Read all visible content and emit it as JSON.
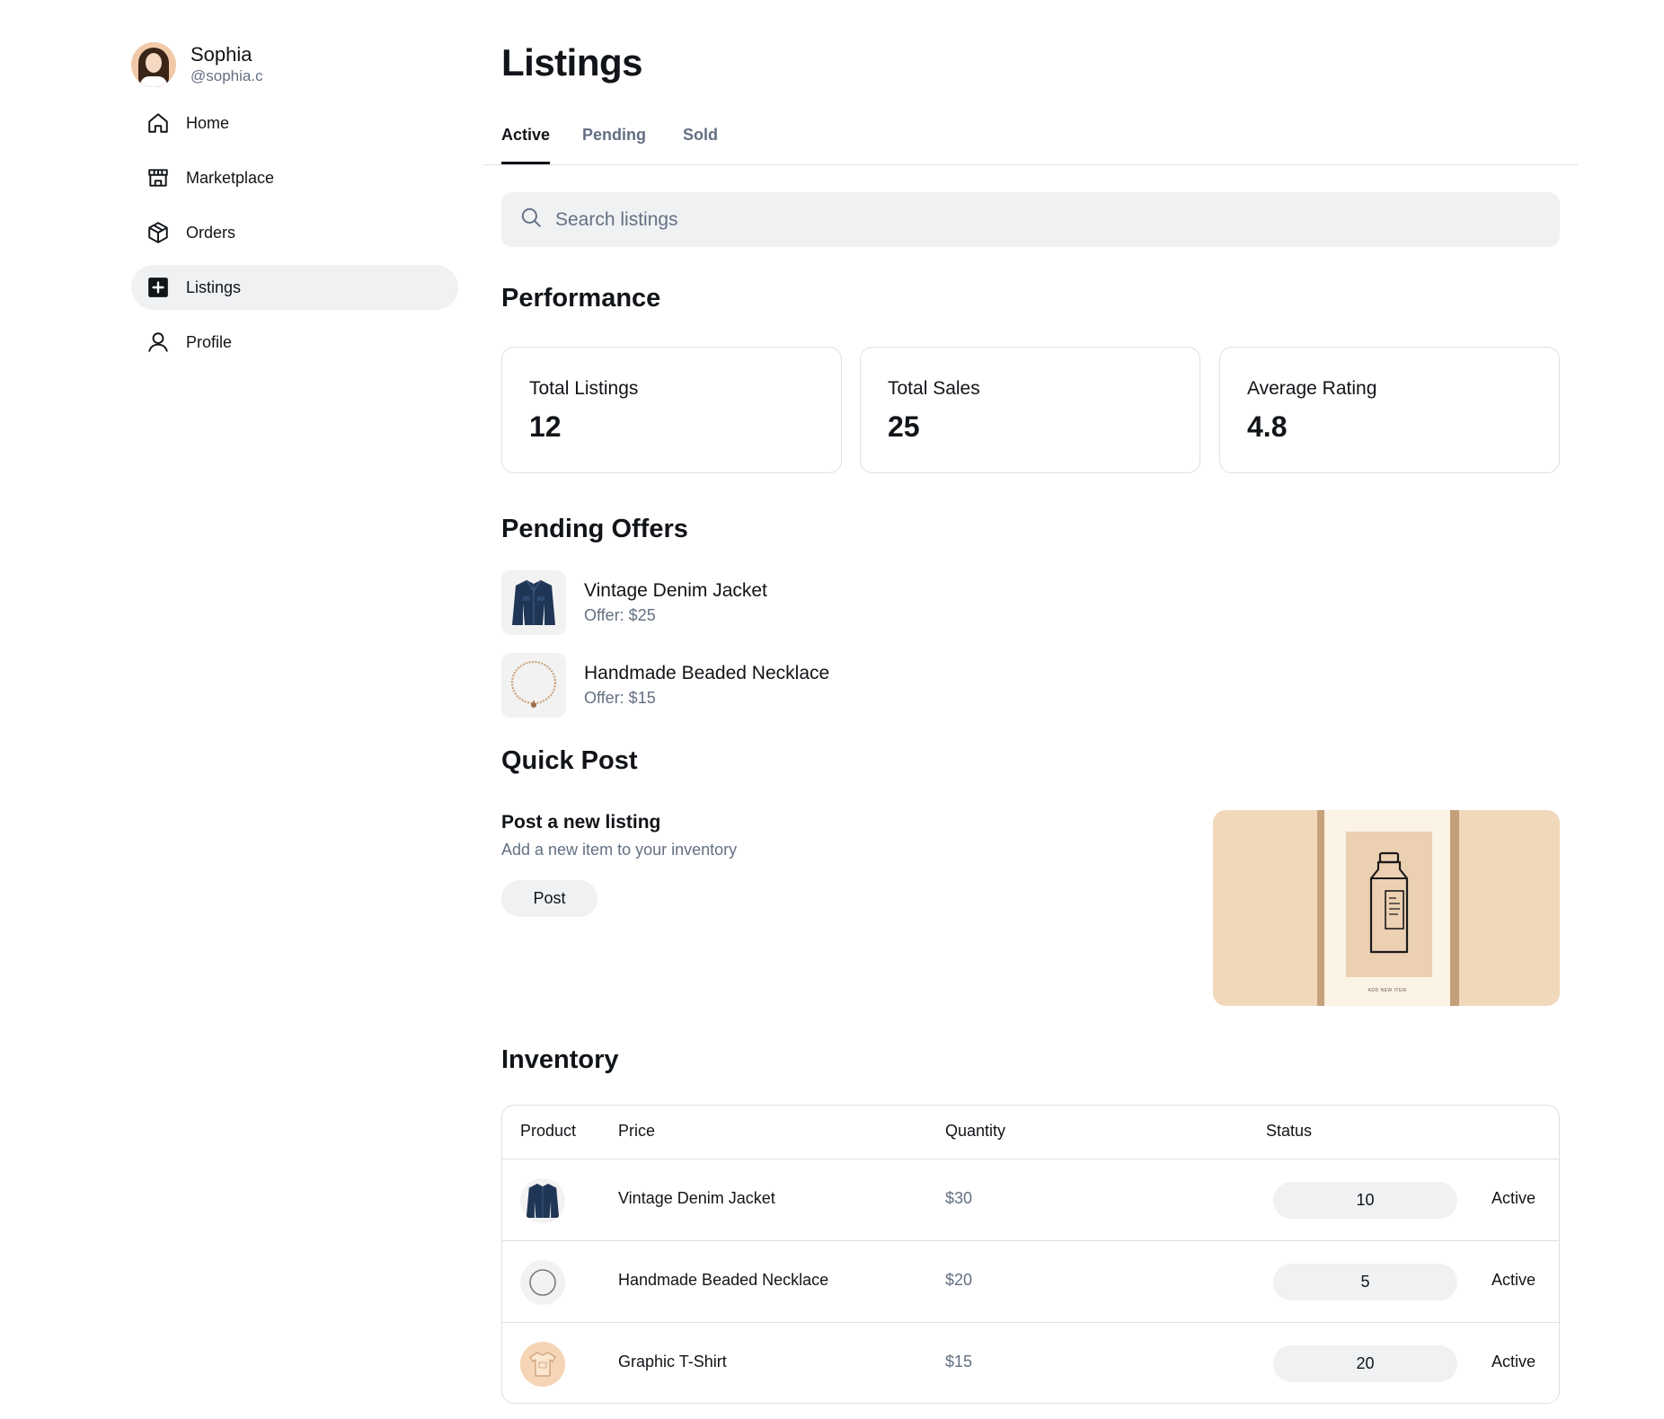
{
  "user": {
    "name": "Sophia",
    "handle": "@sophia.c"
  },
  "nav": [
    {
      "label": "Home",
      "icon": "home-icon"
    },
    {
      "label": "Marketplace",
      "icon": "store-icon"
    },
    {
      "label": "Orders",
      "icon": "package-icon"
    },
    {
      "label": "Listings",
      "icon": "plus-square-icon",
      "active": true
    },
    {
      "label": "Profile",
      "icon": "user-icon"
    }
  ],
  "page": {
    "title": "Listings"
  },
  "tabs": [
    {
      "label": "Active",
      "active": true
    },
    {
      "label": "Pending"
    },
    {
      "label": "Sold"
    }
  ],
  "search": {
    "placeholder": "Search listings"
  },
  "performance": {
    "title": "Performance",
    "stats": [
      {
        "label": "Total Listings",
        "value": "12"
      },
      {
        "label": "Total Sales",
        "value": "25"
      },
      {
        "label": "Average Rating",
        "value": "4.8"
      }
    ]
  },
  "pending_offers": {
    "title": "Pending Offers",
    "items": [
      {
        "name": "Vintage Denim Jacket",
        "offer": "Offer: $25"
      },
      {
        "name": "Handmade Beaded Necklace",
        "offer": "Offer: $15"
      }
    ]
  },
  "quick_post": {
    "title": "Quick Post",
    "heading": "Post a new listing",
    "subtitle": "Add a new item to your inventory",
    "button": "Post",
    "image_caption": "ADD NEW ITEM"
  },
  "inventory": {
    "title": "Inventory",
    "columns": [
      "Product",
      "Price",
      "Quantity",
      "Status"
    ],
    "rows": [
      {
        "product": "Vintage Denim Jacket",
        "price": "$30",
        "quantity": "10",
        "status": "Active"
      },
      {
        "product": "Handmade Beaded Necklace",
        "price": "$20",
        "quantity": "5",
        "status": "Active"
      },
      {
        "product": "Graphic T-Shirt",
        "price": "$15",
        "quantity": "20",
        "status": "Active"
      }
    ]
  },
  "colors": {
    "text": "#111418",
    "muted": "#637083",
    "surface": "#eff1f3",
    "border": "#dbe0e5"
  }
}
